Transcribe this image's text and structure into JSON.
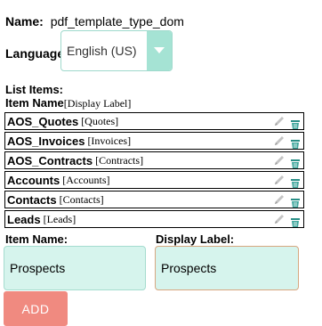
{
  "name": {
    "label": "Name:",
    "value": "pdf_template_type_dom"
  },
  "language": {
    "label": "Language:",
    "selected": "English (US)"
  },
  "list": {
    "title": "List Items:",
    "header_item": "Item Name",
    "header_display": "[Display Label]",
    "items": [
      {
        "key": "AOS_Quotes",
        "display": "[Quotes]"
      },
      {
        "key": "AOS_Invoices",
        "display": "[Invoices]"
      },
      {
        "key": "AOS_Contracts",
        "display": "[Contracts]"
      },
      {
        "key": "Accounts",
        "display": "[Accounts]"
      },
      {
        "key": "Contacts",
        "display": "[Contacts]"
      },
      {
        "key": "Leads",
        "display": "[Leads]"
      }
    ]
  },
  "form": {
    "item_name_label": "Item Name:",
    "display_label_label": "Display Label:",
    "item_name_value": "Prospects",
    "display_label_value": "Prospects",
    "add_label": "ADD"
  },
  "icons": {
    "edit": "pencil-icon",
    "delete": "delete-icon",
    "dropdown": "chevron-down-icon"
  },
  "colors": {
    "accent": "#a5e3d4",
    "input_bg": "#d6f4ed",
    "add_button": "#f08a80",
    "focus_border": "#d7a780"
  }
}
